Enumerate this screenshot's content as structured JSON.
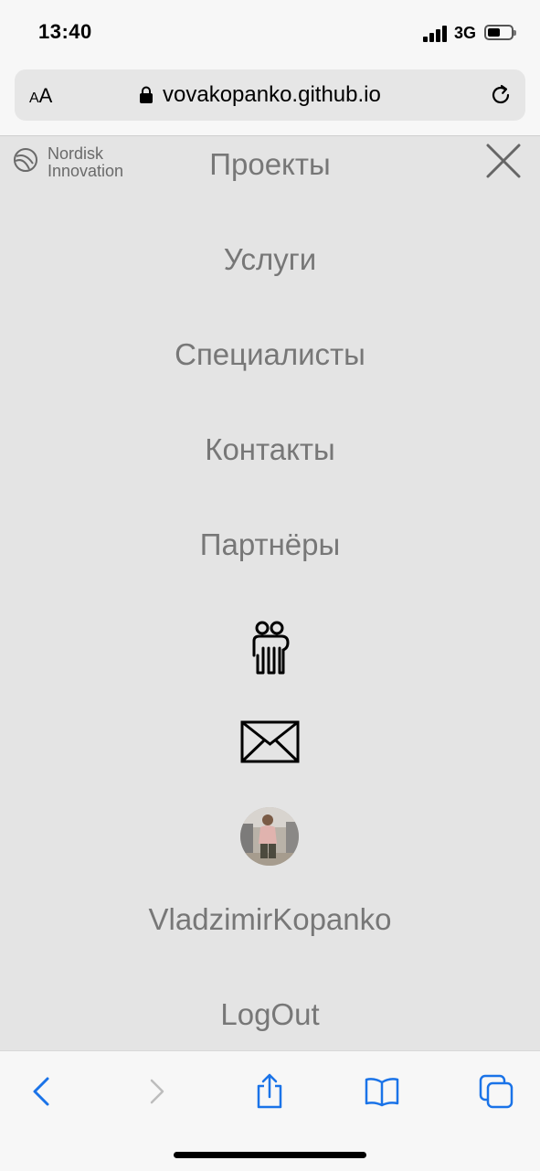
{
  "status": {
    "time": "13:40",
    "network": "3G"
  },
  "browser": {
    "aa_small": "A",
    "aa_big": "A",
    "url": "vovakopanko.github.io"
  },
  "logo": {
    "line1": "Nordisk",
    "line2": "Innovation"
  },
  "menu": {
    "items": [
      "Проекты",
      "Услуги",
      "Специалисты",
      "Контакты",
      "Партнёры"
    ],
    "username": "VladzimirKopanko",
    "logout": "LogOut"
  },
  "icons": [
    "people-icon",
    "mail-icon",
    "close-icon",
    "share-icon",
    "bookmarks-icon",
    "tabs-icon",
    "back-icon",
    "forward-icon"
  ],
  "colors": {
    "menu_bg": "#e4e4e4",
    "menu_text": "#777777",
    "ios_blue": "#1a73e8"
  }
}
